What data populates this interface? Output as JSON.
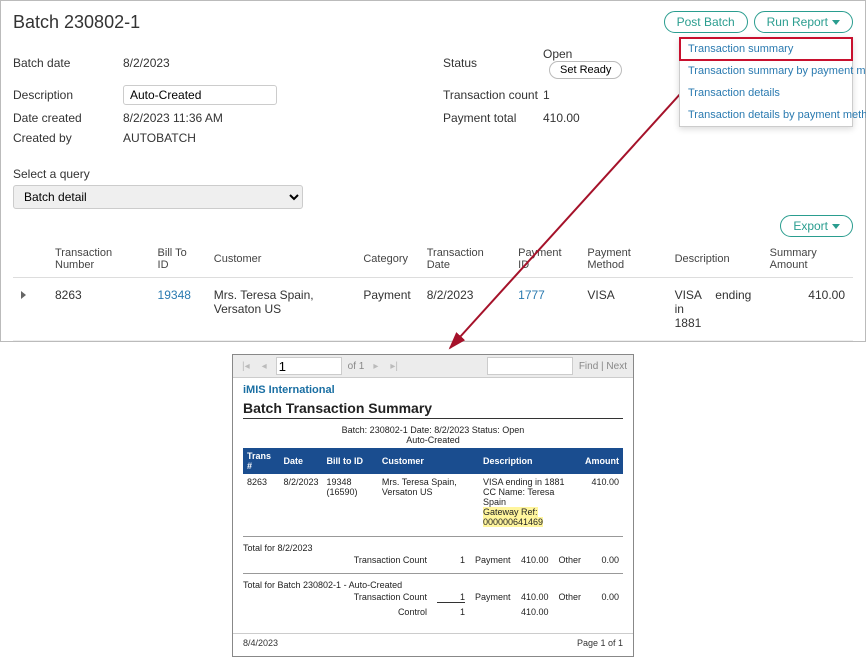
{
  "header": {
    "title": "Batch 230802-1",
    "post_batch": "Post Batch",
    "run_report": "Run Report"
  },
  "run_report_menu": [
    "Transaction summary",
    "Transaction summary by payment method",
    "Transaction details",
    "Transaction details by payment method"
  ],
  "meta": {
    "batch_date_lbl": "Batch date",
    "batch_date": "8/2/2023",
    "description_lbl": "Description",
    "description": "Auto-Created",
    "date_created_lbl": "Date created",
    "date_created": "8/2/2023 11:36 AM",
    "created_by_lbl": "Created by",
    "created_by": "AUTOBATCH",
    "status_lbl": "Status",
    "status": "Open",
    "set_ready_btn": "Set Ready",
    "txn_count_lbl": "Transaction count",
    "txn_count": "1",
    "pay_total_lbl": "Payment total",
    "pay_total": "410.00"
  },
  "query": {
    "label": "Select a query",
    "value": "Batch detail"
  },
  "export_btn": "Export",
  "grid": {
    "cols": {
      "txn_no": "Transaction Number",
      "bill_to": "Bill To ID",
      "customer": "Customer",
      "category": "Category",
      "txn_date": "Transaction Date",
      "payment_id": "Payment ID",
      "pay_method": "Payment Method",
      "desc": "Description",
      "amount": "Summary Amount"
    },
    "row": {
      "txn_no": "8263",
      "bill_to": "19348",
      "customer": "Mrs. Teresa Spain, Versaton US",
      "category": "Payment",
      "txn_date": "8/2/2023",
      "payment_id": "1777",
      "pay_method": "VISA",
      "desc_card": "VISA",
      "desc_ending": "ending in",
      "desc_last4": "1881",
      "amount": "410.00"
    }
  },
  "report_toolbar": {
    "page_val": "1",
    "page_of": "of 1",
    "find_next": "Find | Next"
  },
  "report": {
    "org": "iMIS International",
    "title": "Batch Transaction Summary",
    "sub1": "Batch: 230802-1  Date: 8/2/2023  Status: Open",
    "sub2": "Auto-Created",
    "cols": {
      "trans": "Trans #",
      "date": "Date",
      "bill_to": "Bill to ID",
      "customer": "Customer",
      "desc": "Description",
      "amount": "Amount"
    },
    "row": {
      "trans": "8263",
      "date": "8/2/2023",
      "bill_to": "19348 (16590)",
      "customer": "Mrs. Teresa Spain, Versaton US",
      "desc_l1": "VISA     ending in 1881",
      "desc_l2": "CC Name: Teresa Spain",
      "desc_l3": "Gateway Ref: 000000641469",
      "amount": "410.00"
    },
    "totals_date_hdr": "Total for 8/2/2023",
    "totals_batch_hdr": "Total for Batch 230802-1 - Auto-Created",
    "tc_lbl": "Transaction Count",
    "tc_val": "1",
    "control_lbl": "Control",
    "control_val": "1",
    "pay_lbl": "Payment",
    "pay_val": "410.00",
    "other_lbl": "Other",
    "other_val": "0.00",
    "footer_date": "8/4/2023",
    "footer_page": "Page 1 of  1"
  }
}
